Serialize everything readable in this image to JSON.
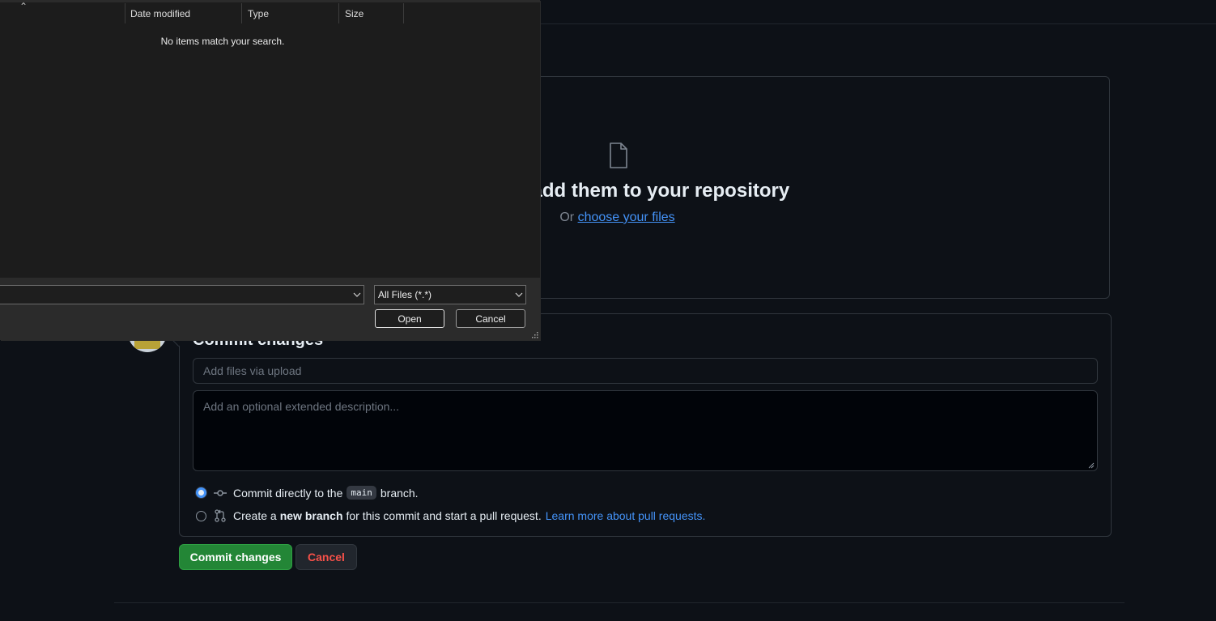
{
  "github": {
    "dropzone": {
      "title": "s here to add them to your repository",
      "or_text": "Or",
      "choose_link": "choose your files"
    },
    "commit": {
      "title": "Commit changes",
      "summary_placeholder": "Add files via upload",
      "description_placeholder": "Add an optional extended description...",
      "option_direct": {
        "prefix": "Commit directly to the",
        "branch": "main",
        "suffix": "branch.",
        "selected": true
      },
      "option_new_branch": {
        "prefix": "Create a",
        "bold": "new branch",
        "suffix": "for this commit and start a pull request.",
        "link": "Learn more about pull requests.",
        "selected": false
      },
      "commit_button": "Commit changes",
      "cancel_button": "Cancel"
    },
    "colors": {
      "background": "#0d1117",
      "border": "#30363d",
      "link": "#4493f8",
      "primary_button": "#238636",
      "danger_text": "#f85149"
    }
  },
  "file_dialog": {
    "columns": [
      "Date modified",
      "Type",
      "Size"
    ],
    "empty_message": "No items match your search.",
    "file_name_value": "",
    "file_type_filter": "All Files (*.*)",
    "open_button": "Open",
    "cancel_button": "Cancel",
    "icons": [
      "sort-up-icon",
      "chevron-down-icon",
      "resize-grip-icon"
    ]
  }
}
